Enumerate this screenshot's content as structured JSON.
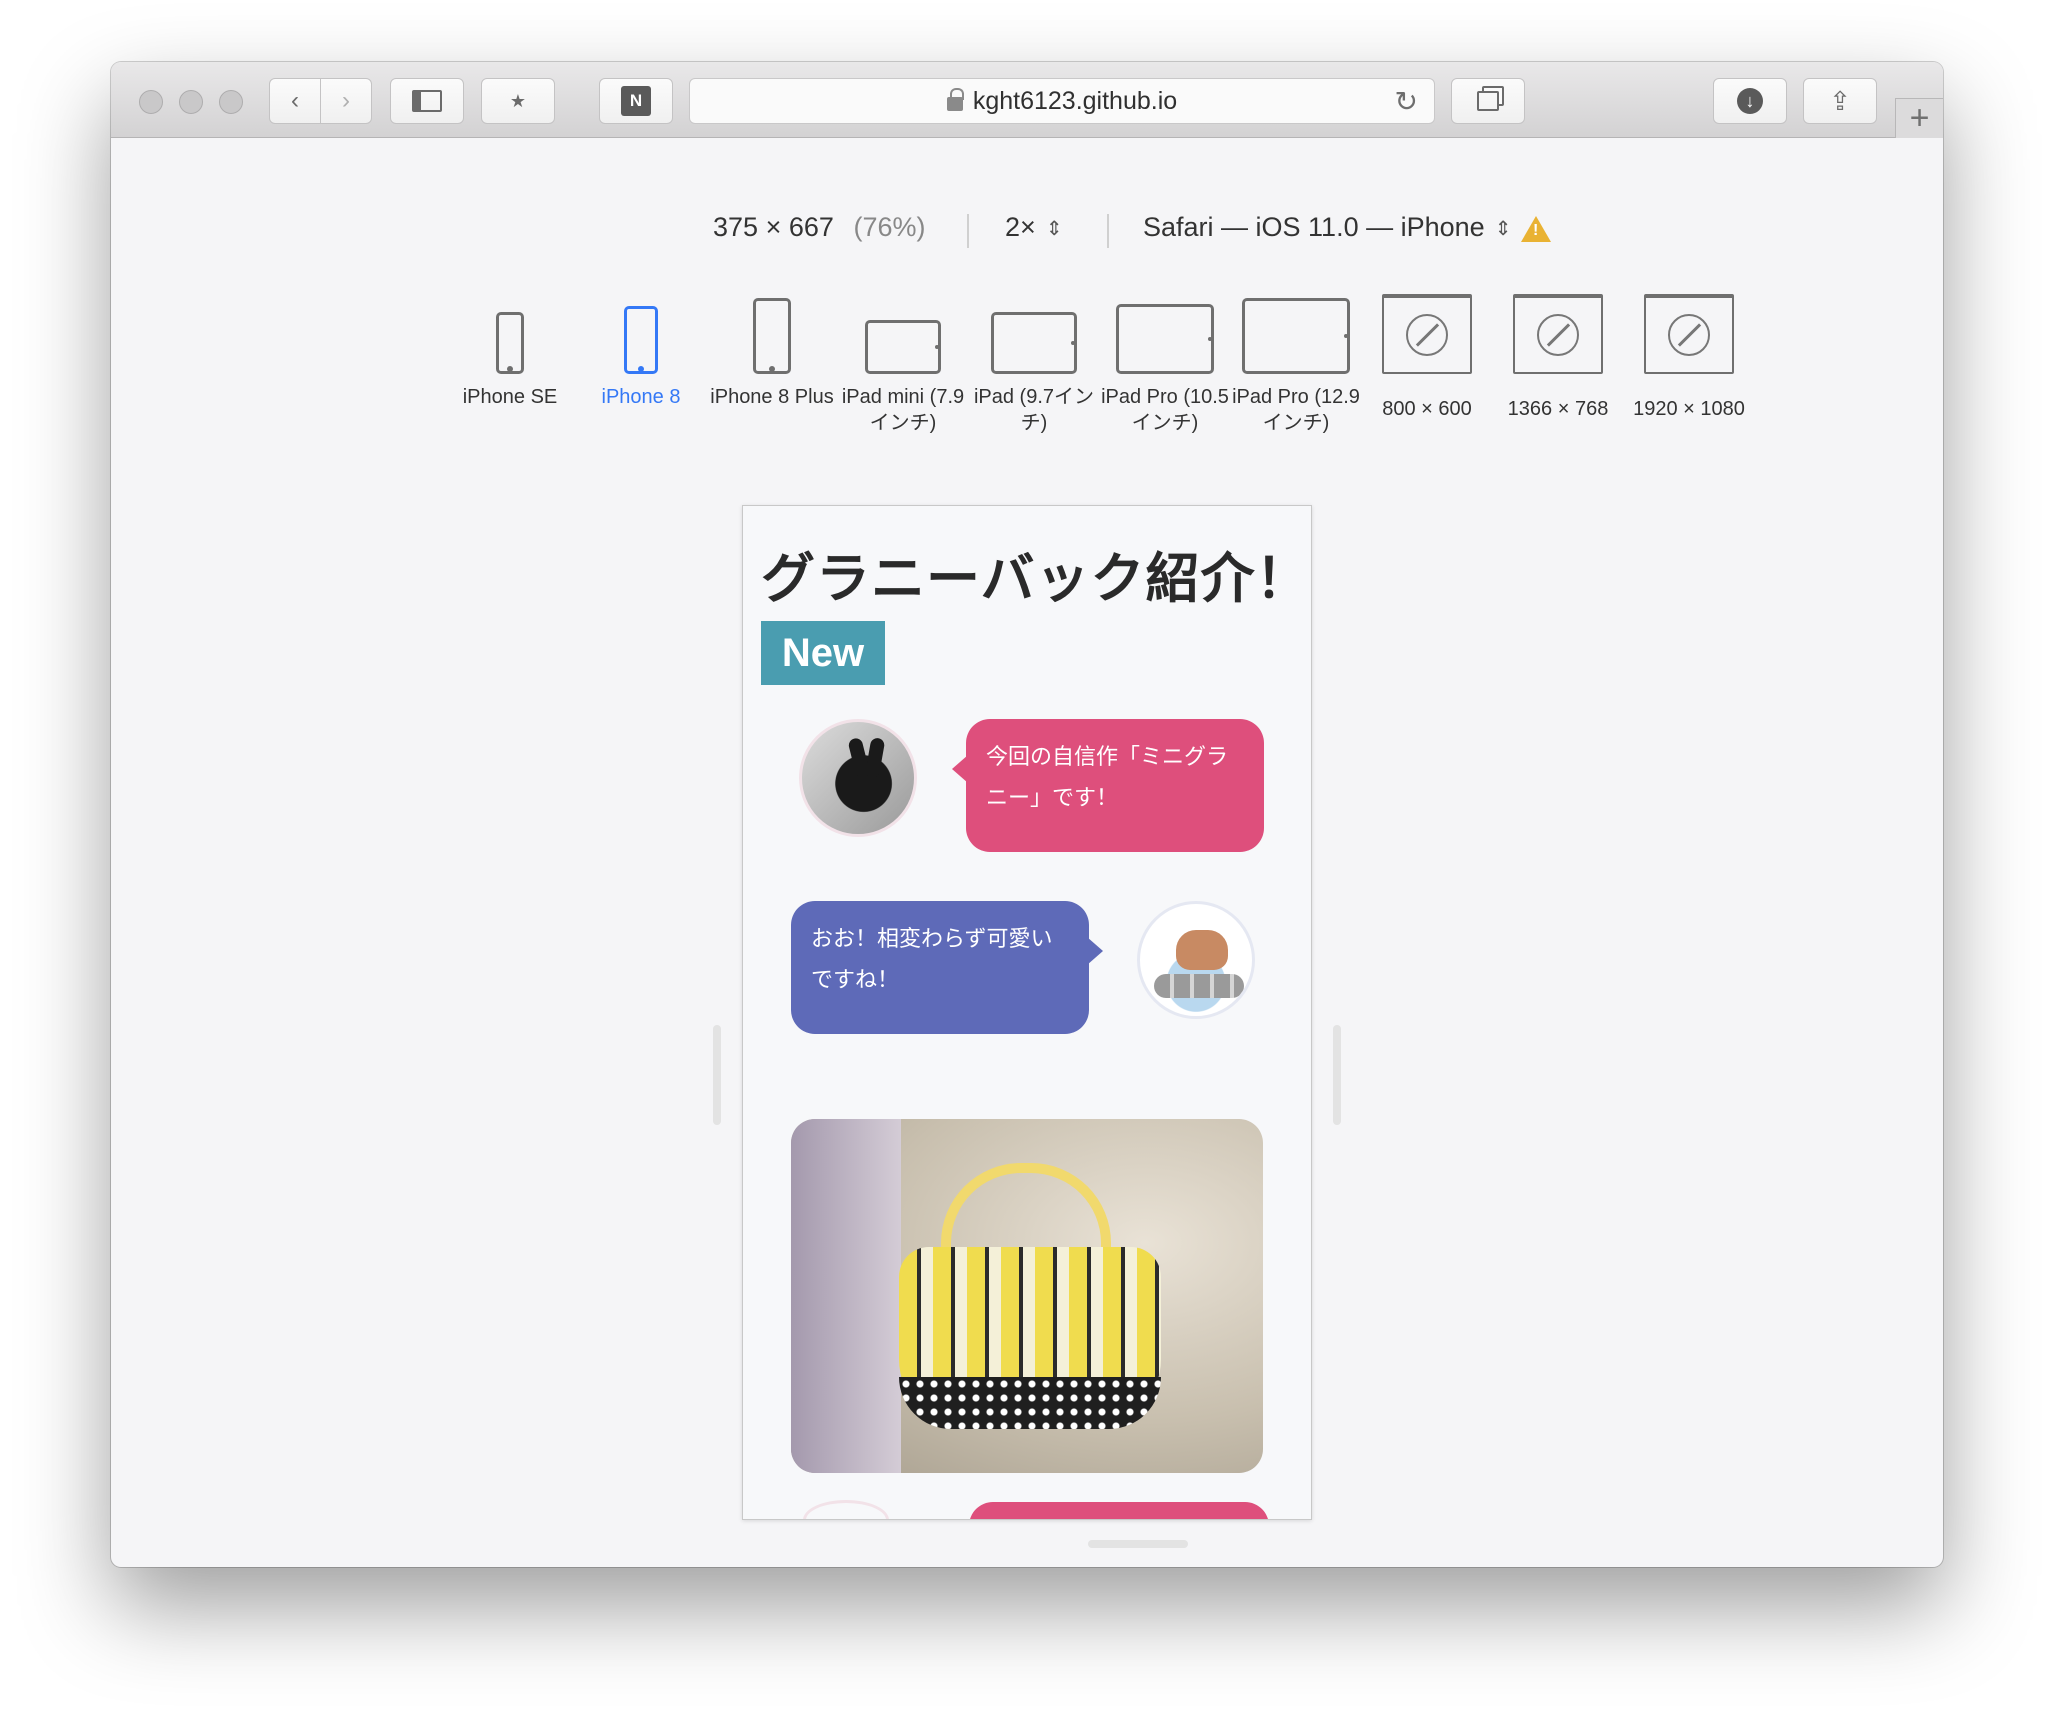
{
  "browser": {
    "url": "kght6123.github.io",
    "new_tab_label": "+"
  },
  "responsive_bar": {
    "width": "375",
    "height": "667",
    "times": "×",
    "zoom": "(76%)",
    "scale": "2×",
    "user_agent": "Safari — iOS 11.0 — iPhone"
  },
  "devices": [
    {
      "label": "iPhone SE",
      "active": false
    },
    {
      "label": "iPhone 8",
      "active": true
    },
    {
      "label": "iPhone 8 Plus",
      "active": false
    },
    {
      "label": "iPad mini (7.9インチ)",
      "active": false
    },
    {
      "label": "iPad (9.7インチ)",
      "active": false
    },
    {
      "label": "iPad Pro (10.5インチ)",
      "active": false
    },
    {
      "label": "iPad Pro (12.9インチ)",
      "active": false
    },
    {
      "label": "800 × 600",
      "active": false
    },
    {
      "label": "1366 × 768",
      "active": false
    },
    {
      "label": "1920 × 1080",
      "active": false
    }
  ],
  "page": {
    "title": "グラニーバック紹介！",
    "badge": "New",
    "messages": [
      {
        "speaker": "rabbit",
        "text": "今回の自信作「ミニグラニー」です！"
      },
      {
        "speaker": "capybara",
        "text": "おお！相変わらず可愛いですね！"
      }
    ]
  },
  "colors": {
    "badge": "#4a9db0",
    "bubble_pink": "#de4f7c",
    "bubble_blue": "#5e6ab8",
    "active_device": "#3478f6"
  }
}
